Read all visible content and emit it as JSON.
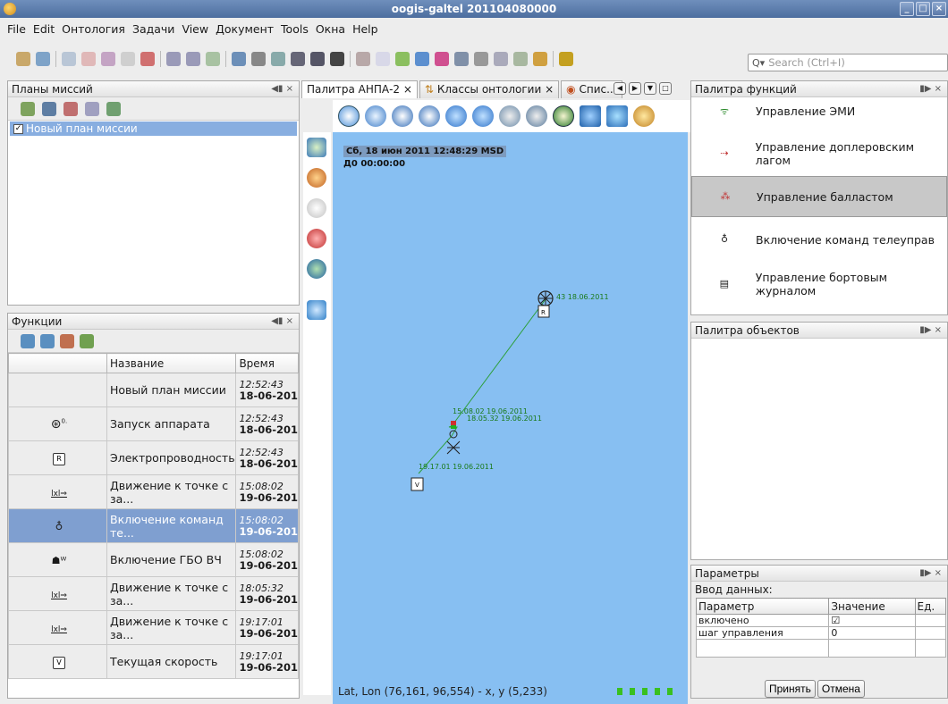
{
  "window": {
    "title": "oogis-galtel 201104080000"
  },
  "menu": [
    "File",
    "Edit",
    "Онтология",
    "Задачи",
    "View",
    "Документ",
    "Tools",
    "Окна",
    "Help"
  ],
  "search": {
    "placeholder": "Search (Ctrl+I)"
  },
  "missions_panel": {
    "title": "Планы миссий",
    "items": [
      {
        "label": "Новый план миссии",
        "checked": true
      }
    ]
  },
  "functions_panel": {
    "title": "Функции",
    "columns": [
      "",
      "Название",
      "Время"
    ],
    "rows": [
      {
        "icon": "",
        "name": "Новый план миссии",
        "time": "12:52:43",
        "date": "18-06-201"
      },
      {
        "icon": "launch-icon",
        "name": "Запуск аппарата",
        "time": "12:52:43",
        "date": "18-06-201"
      },
      {
        "icon": "r-icon",
        "name": "Электропроводность",
        "time": "12:52:43",
        "date": "18-06-201"
      },
      {
        "icon": "move-icon",
        "name": "Движение к точке с за...",
        "time": "15:08:02",
        "date": "19-06-201"
      },
      {
        "icon": "telecontrol-icon",
        "name": "Включение команд те...",
        "time": "15:08:02",
        "date": "19-06-201",
        "selected": true
      },
      {
        "icon": "sonar-icon",
        "name": "Включение ГБО ВЧ",
        "time": "15:08:02",
        "date": "19-06-201"
      },
      {
        "icon": "move-icon",
        "name": "Движение к точке с за...",
        "time": "18:05:32",
        "date": "19-06-201"
      },
      {
        "icon": "move-icon",
        "name": "Движение к точке с за...",
        "time": "19:17:01",
        "date": "19-06-201"
      },
      {
        "icon": "v-icon",
        "name": "Текущая скорость",
        "time": "19:17:01",
        "date": "19-06-201"
      }
    ]
  },
  "tabs": [
    "Палитра АНПА-2 ×",
    "Классы онтологии ×",
    "Спис..."
  ],
  "map": {
    "timestamp": "Сб, 18 июн 2011 12:48:29 MSD",
    "delta": "Д0 00:00:00",
    "labels": {
      "p1": "43 18.06.2011",
      "p2": "15.08.02 19.06.2011",
      "p3": "18.05.32 19.06.2011",
      "p4": "19.17.01 19.06.2011"
    },
    "coords": "Lat, Lon (76,161, 96,554) - x, y (5,233)"
  },
  "func_palette": {
    "title": "Палитра функций",
    "items": [
      {
        "icon": "emi-icon",
        "label": "Управление ЭМИ"
      },
      {
        "icon": "doppler-icon",
        "label": "Управление доплеровским лагом"
      },
      {
        "icon": "ballast-icon",
        "label": "Управление балластом",
        "selected": true
      },
      {
        "icon": "telecontrol-icon",
        "label": "Включение команд телеуправлени"
      },
      {
        "icon": "journal-icon",
        "label": "Управление бортовым журналом"
      }
    ]
  },
  "obj_palette": {
    "title": "Палитра объектов"
  },
  "params": {
    "title": "Параметры",
    "section": "Ввод данных:",
    "columns": [
      "Параметр",
      "Значение",
      "Ед."
    ],
    "rows": [
      {
        "name": "включено",
        "value": "☑",
        "unit": ""
      },
      {
        "name": "шаг управления",
        "value": "0",
        "unit": ""
      }
    ],
    "ok_label": "Принять",
    "cancel_label": "Отмена"
  }
}
